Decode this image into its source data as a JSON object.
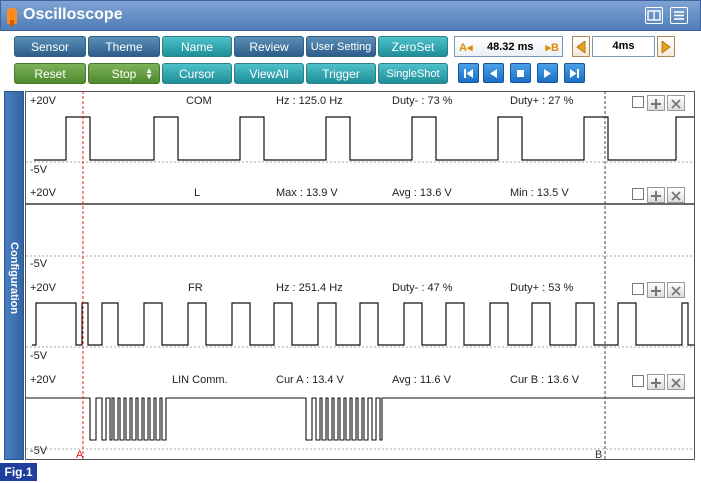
{
  "window": {
    "title": "Oscilloscope",
    "icons": [
      "app-probe-icon",
      "dual-window-icon",
      "menu-list-icon"
    ]
  },
  "toolbar": {
    "row1": [
      "Sensor",
      "Theme",
      "Name",
      "Review",
      "User Setting",
      "ZeroSet"
    ],
    "row2": [
      "Reset",
      "Stop",
      "Cursor",
      "ViewAll",
      "Trigger",
      "SingleShot"
    ],
    "cursor_a": "A",
    "cursor_value": "48.32 ms",
    "cursor_b": "B",
    "time_div": "4ms",
    "playback_icons": [
      "skip-first-icon",
      "step-back-icon",
      "stop-icon",
      "step-forward-icon",
      "skip-last-icon"
    ]
  },
  "sidetab": {
    "label": "Configuration"
  },
  "cursors": {
    "a_label": "A",
    "b_label": "B"
  },
  "channels": [
    {
      "ymax": "+20V",
      "ymin": "-5V",
      "name": "COM",
      "m1": "Hz : 125.0 Hz",
      "m2": "Duty- : 73 %",
      "m3": "Duty+ : 27 %"
    },
    {
      "ymax": "+20V",
      "ymin": "-5V",
      "name": "L",
      "m1": "Max : 13.9 V",
      "m2": "Avg : 13.6 V",
      "m3": "Min : 13.5 V"
    },
    {
      "ymax": "+20V",
      "ymin": "-5V",
      "name": "FR",
      "m1": "Hz : 251.4 Hz",
      "m2": "Duty- : 47 %",
      "m3": "Duty+ : 53 %"
    },
    {
      "ymax": "+20V",
      "ymin": "-5V",
      "name": "LIN Comm.",
      "m1": "Cur A : 13.4 V",
      "m2": "Avg : 11.6 V",
      "m3": "Cur B : 13.6 V"
    }
  ],
  "figure_label": "Fig.1",
  "colors": {
    "titlebar": "#5b87c0",
    "button_blue": "#3a6d98",
    "button_teal": "#2aa3ad",
    "button_green": "#5c9a3a",
    "playback": "#2a82d8",
    "cursor_line": "#e02020",
    "figure_label_bg": "#1f3f9e"
  }
}
